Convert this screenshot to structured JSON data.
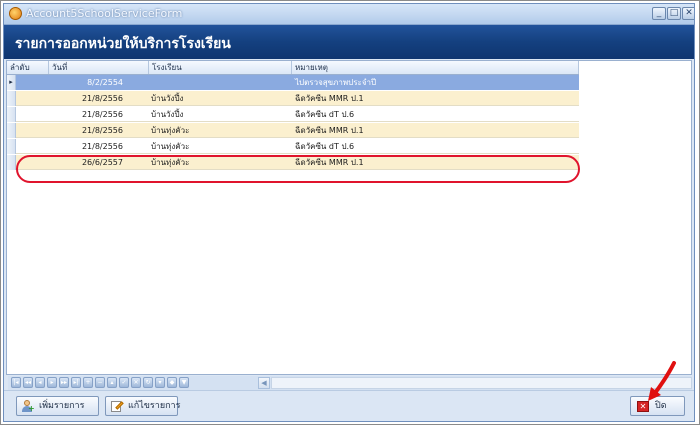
{
  "window": {
    "title": "Account5SchoolServiceForm",
    "buttons": {
      "minimize": "_",
      "maximize": "□",
      "close": "✕"
    }
  },
  "page": {
    "title": "รายการออกหน่วยให้บริการโรงเรียน"
  },
  "grid": {
    "columns": [
      "ลำดับ",
      "วันที่",
      "โรงเรียน",
      "หมายเหตุ"
    ],
    "current_row_marker": "▸",
    "rows": [
      {
        "date": "8/2/2554",
        "school": "",
        "note": "ไปตรวจสุขภาพประจำปี",
        "current": true
      },
      {
        "date": "21/8/2556",
        "school": "บ้านวังปึ้ง",
        "note": "ฉีดวัคซีน MMR ป.1"
      },
      {
        "date": "21/8/2556",
        "school": "บ้านวังปึ้ง",
        "note": "ฉีดวัคซีน dT ป.6"
      },
      {
        "date": "21/8/2556",
        "school": "บ้านทุ่งคัวะ",
        "note": "ฉีดวัคซีน MMR ป.1"
      },
      {
        "date": "21/8/2556",
        "school": "บ้านทุ่งคัวะ",
        "note": "ฉีดวัคซีน dT ป.6"
      },
      {
        "date": "26/6/2557",
        "school": "บ้านทุ่งคัวะ",
        "note": "ฉีดวัคซีน MMR ป.1",
        "highlighted": true
      }
    ]
  },
  "navigator": {
    "buttons": [
      "first-icon",
      "prev-page-icon",
      "prev-icon",
      "next-icon",
      "next-page-icon",
      "last-icon",
      "append-icon",
      "delete-icon",
      "edit-icon",
      "post-icon",
      "cancel-icon",
      "refresh-icon",
      "filter-icon",
      "bookmark-icon",
      "goto-icon"
    ],
    "scroll_left": "◀"
  },
  "footer": {
    "add_label": "เพิ่มรายการ",
    "edit_label": "แก้ไขรายการ",
    "close_label": "ปิด"
  },
  "colors": {
    "header_blue": "#14407f",
    "current_row": "#8aaae0",
    "alt_row": "#fbf0cf",
    "highlight_ring": "#e0142d"
  }
}
